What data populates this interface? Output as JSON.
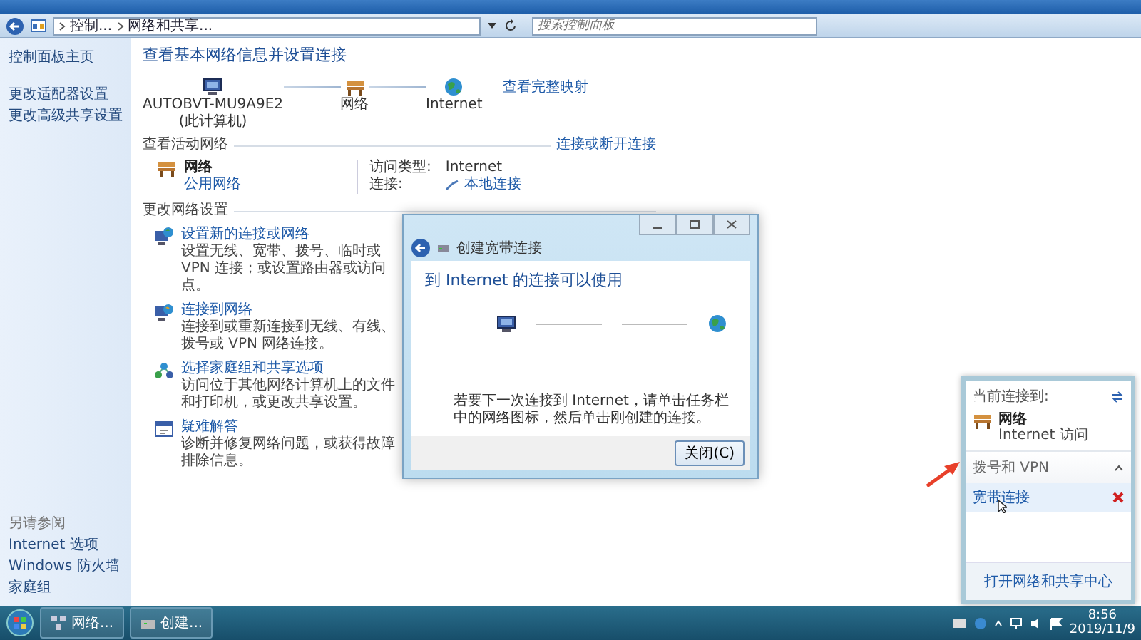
{
  "window": {
    "breadcrumb": [
      "控制...",
      "网络和共享..."
    ],
    "search": {
      "placeholder": "搜索控制面板"
    }
  },
  "sidebar": {
    "links": [
      "控制面板主页",
      "更改适配器设置",
      "更改高级共享设置"
    ],
    "see_also": {
      "heading": "另请参阅",
      "links": [
        "Internet 选项",
        "Windows 防火墙",
        "家庭组"
      ]
    }
  },
  "main": {
    "title": "查看基本网络信息并设置连接",
    "map_link": "查看完整映射",
    "map_nodes": [
      {
        "kind": "computer",
        "label": "AUTOBVT-MU9A9E2",
        "sublabel": "(此计算机)"
      },
      {
        "kind": "network",
        "label": "网络"
      },
      {
        "kind": "internet",
        "label": "Internet"
      }
    ],
    "active_networks": {
      "heading": "查看活动网络",
      "link": "连接或断开连接",
      "network": {
        "name": "网络",
        "type": "公用网络"
      },
      "fields": [
        {
          "label": "访问类型:",
          "value": "Internet",
          "kind": "text"
        },
        {
          "label": "连接:",
          "value": "本地连接",
          "kind": "link"
        }
      ]
    },
    "settings": {
      "heading": "更改网络设置",
      "items": [
        {
          "kind": "new-connection",
          "title": "设置新的连接或网络",
          "description": "设置无线、宽带、拨号、临时或 VPN 连接；或设置路由器或访问点。"
        },
        {
          "kind": "connect",
          "title": "连接到网络",
          "description": "连接到或重新连接到无线、有线、拨号或 VPN 网络连接。"
        },
        {
          "kind": "homegroup",
          "title": "选择家庭组和共享选项",
          "description": "访问位于其他网络计算机上的文件和打印机，或更改共享设置。"
        },
        {
          "kind": "troubleshoot",
          "title": "疑难解答",
          "description": "诊断并修复网络问题，或获得故障排除信息。"
        }
      ]
    }
  },
  "dialog": {
    "title": "创建宽带连接",
    "heading": "到 Internet 的连接可以使用",
    "message": "若要下一次连接到 Internet，请单击任务栏中的网络图标，然后单击刚创建的连接。",
    "button": "关闭(C)"
  },
  "flyout": {
    "heading": "当前连接到:",
    "network": {
      "name": "网络",
      "status": "Internet 访问"
    },
    "section": "拨号和 VPN",
    "connections": [
      {
        "name": "宽带连接",
        "selected": true
      }
    ],
    "footer_link": "打开网络和共享中心"
  },
  "taskbar": {
    "buttons": [
      {
        "kind": "network",
        "label": "网络..."
      },
      {
        "kind": "dialog",
        "label": "创建..."
      }
    ],
    "time": "8:56",
    "date": "2019/11/9"
  }
}
